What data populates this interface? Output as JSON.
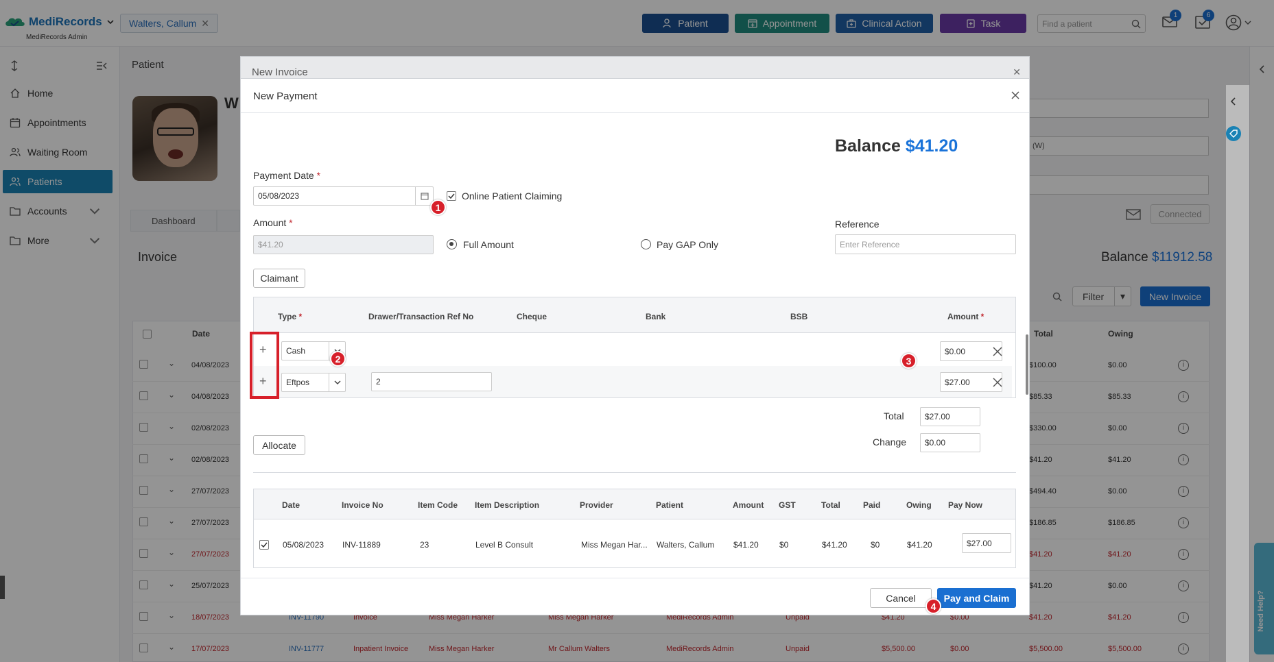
{
  "header": {
    "logo_text": "MediRecords",
    "logo_sub": "MediRecords Admin",
    "patient_tab": "Walters, Callum",
    "buttons": {
      "patient": "Patient",
      "appointment": "Appointment",
      "clinical_action": "Clinical Action",
      "task": "Task"
    },
    "search_placeholder": "Find a patient",
    "mail_count": "1",
    "tasks_count": "6",
    "colors": {
      "patient": "#1a4f8f",
      "appointment": "#1f8a7e",
      "clinical_action": "#1f5fa6",
      "task": "#6a3aa6"
    }
  },
  "sidebar": {
    "items": [
      {
        "label": "Home",
        "icon": "home-icon"
      },
      {
        "label": "Appointments",
        "icon": "calendar-icon"
      },
      {
        "label": "Waiting Room",
        "icon": "users-icon"
      },
      {
        "label": "Patients",
        "icon": "users-icon",
        "active": true
      },
      {
        "label": "Accounts",
        "icon": "folder-icon"
      },
      {
        "label": "More",
        "icon": "folder-icon"
      }
    ]
  },
  "background": {
    "section": "Patient",
    "name_initial": "W",
    "tab_dashboard": "Dashboard",
    "invoice_title": "Invoice",
    "balance_label": "Balance",
    "balance_value": "$11912.58",
    "filter": "Filter",
    "new_invoice": "New Invoice",
    "connected": "Connected",
    "right_field_1": "(W)",
    "columns": {
      "date": "Date",
      "total": "Total",
      "owing": "Owing"
    },
    "rows": [
      {
        "date": "04/08/2023",
        "total": "$100.00",
        "owing": "$0.00",
        "red": false
      },
      {
        "date": "04/08/2023",
        "total": "$85.33",
        "owing": "$85.33",
        "red": false
      },
      {
        "date": "02/08/2023",
        "total": "$330.00",
        "owing": "$0.00",
        "red": false
      },
      {
        "date": "02/08/2023",
        "total": "$41.20",
        "owing": "$41.20",
        "red": false
      },
      {
        "date": "27/07/2023",
        "total": "$494.40",
        "owing": "$0.00",
        "red": false
      },
      {
        "date": "27/07/2023",
        "total": "$186.85",
        "owing": "$186.85",
        "red": false
      },
      {
        "date": "27/07/2023",
        "total": "$41.20",
        "owing": "$41.20",
        "red": true
      },
      {
        "date": "25/07/2023",
        "total": "$41.20",
        "owing": "$0.00",
        "red": false
      },
      {
        "date": "18/07/2023",
        "inv": "INV-11790",
        "type": "Invoice",
        "prov": "Miss Megan Harker",
        "prov2": "Miss Megan Harker",
        "loc": "MediRecords Admin",
        "status": "Unpaid",
        "amt": "$41.20",
        "paid": "$0.00",
        "total": "$41.20",
        "owing": "$41.20",
        "red": true
      },
      {
        "date": "17/07/2023",
        "inv": "INV-11777",
        "type": "Inpatient Invoice",
        "prov": "Miss Megan Harker",
        "prov2": "Mr Callum Walters",
        "loc": "MediRecords Admin",
        "status": "Unpaid",
        "amt": "$5,500.00",
        "paid": "$0.00",
        "total": "$5,500.00",
        "owing": "$5,500.00",
        "red": true
      }
    ]
  },
  "back_modal": {
    "title": "New Invoice"
  },
  "modal": {
    "title": "New Payment",
    "balance_label": "Balance",
    "balance_value": "$41.20",
    "payment_date_label": "Payment Date",
    "payment_date_value": "05/08/2023",
    "online_claiming_label": "Online Patient Claiming",
    "online_claiming_checked": true,
    "amount_label": "Amount",
    "amount_value": "$41.20",
    "full_amount_label": "Full Amount",
    "pay_gap_label": "Pay GAP Only",
    "reference_label": "Reference",
    "reference_placeholder": "Enter Reference",
    "claimant_button": "Claimant",
    "payment_columns": {
      "type": "Type",
      "drawer": "Drawer/Transaction Ref No",
      "cheque": "Cheque",
      "bank": "Bank",
      "bsb": "BSB",
      "amount": "Amount"
    },
    "payments": [
      {
        "type": "Cash",
        "ref": "",
        "amount": "$0.00"
      },
      {
        "type": "Eftpos",
        "ref": "2",
        "amount": "$27.00"
      }
    ],
    "total_label": "Total",
    "total_value": "$27.00",
    "change_label": "Change",
    "change_value": "$0.00",
    "allocate_button": "Allocate",
    "alloc_columns": {
      "date": "Date",
      "invoice_no": "Invoice No",
      "item_code": "Item Code",
      "item_desc": "Item Description",
      "provider": "Provider",
      "patient": "Patient",
      "amount": "Amount",
      "gst": "GST",
      "total": "Total",
      "paid": "Paid",
      "owing": "Owing",
      "pay_now": "Pay Now"
    },
    "alloc_row": {
      "date": "05/08/2023",
      "invoice_no": "INV-11889",
      "item_code": "23",
      "item_desc": "Level B Consult",
      "provider": "Miss Megan Har...",
      "patient": "Walters, Callum",
      "amount": "$41.20",
      "gst": "$0",
      "total": "$41.20",
      "paid": "$0",
      "owing": "$41.20",
      "pay_now": "$27.00"
    },
    "cancel_button": "Cancel",
    "pay_claim_button": "Pay and Claim"
  },
  "markers": [
    "1",
    "2",
    "3",
    "4"
  ],
  "help_tab": "Need Help?"
}
